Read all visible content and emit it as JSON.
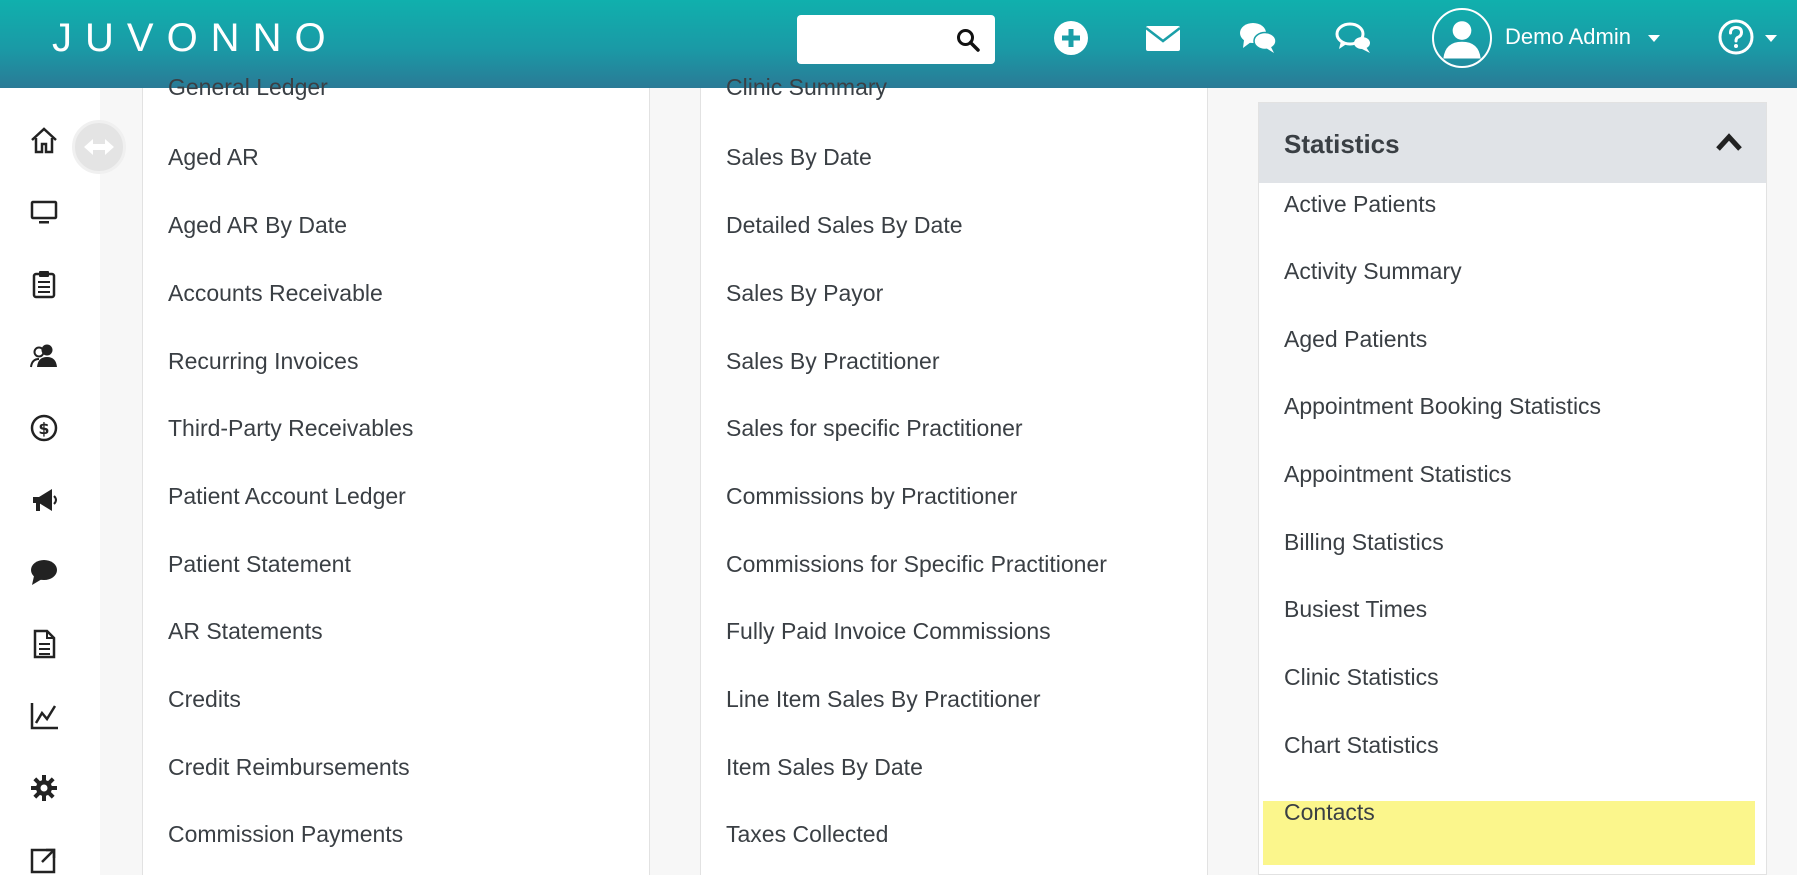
{
  "header": {
    "logo": "JUVONNO",
    "search": {
      "value": "",
      "placeholder": ""
    },
    "user_name": "Demo Admin"
  },
  "icons": {
    "top": [
      "search-icon",
      "plus-circle-icon",
      "envelope-icon",
      "chat-icon",
      "chat-bubbles-icon",
      "user-icon",
      "help-icon"
    ],
    "sidebar": [
      "home-icon",
      "monitor-icon",
      "clipboard-icon",
      "users-icon",
      "dollar-icon",
      "megaphone-icon",
      "comment-icon",
      "document-icon",
      "chart-icon",
      "gear-icon",
      "external-link-icon"
    ]
  },
  "column1": {
    "items": [
      "General Ledger",
      "Aged AR",
      "Aged AR By Date",
      "Accounts Receivable",
      "Recurring Invoices",
      "Third-Party Receivables",
      "Patient Account Ledger",
      "Patient Statement",
      "AR Statements",
      "Credits",
      "Credit Reimbursements",
      "Commission Payments"
    ]
  },
  "column2": {
    "items": [
      "Clinic Summary",
      "Sales By Date",
      "Detailed Sales By Date",
      "Sales By Payor",
      "Sales By Practitioner",
      "Sales for specific Practitioner",
      "Commissions by Practitioner",
      "Commissions for Specific Practitioner",
      "Fully Paid Invoice Commissions",
      "Line Item Sales By Practitioner",
      "Item Sales By Date",
      "Taxes Collected"
    ]
  },
  "statistics": {
    "title": "Statistics",
    "items": [
      "Active Patients",
      "Activity Summary",
      "Aged Patients",
      "Appointment Booking Statistics",
      "Appointment Statistics",
      "Billing Statistics",
      "Busiest Times",
      "Clinic Statistics",
      "Chart Statistics",
      "Contacts"
    ],
    "highlighted": "Contacts"
  },
  "colors": {
    "header_start": "#10b0ad",
    "header_end": "#2a7a96",
    "highlight": "#fbf68c",
    "text": "#3a3f44"
  }
}
